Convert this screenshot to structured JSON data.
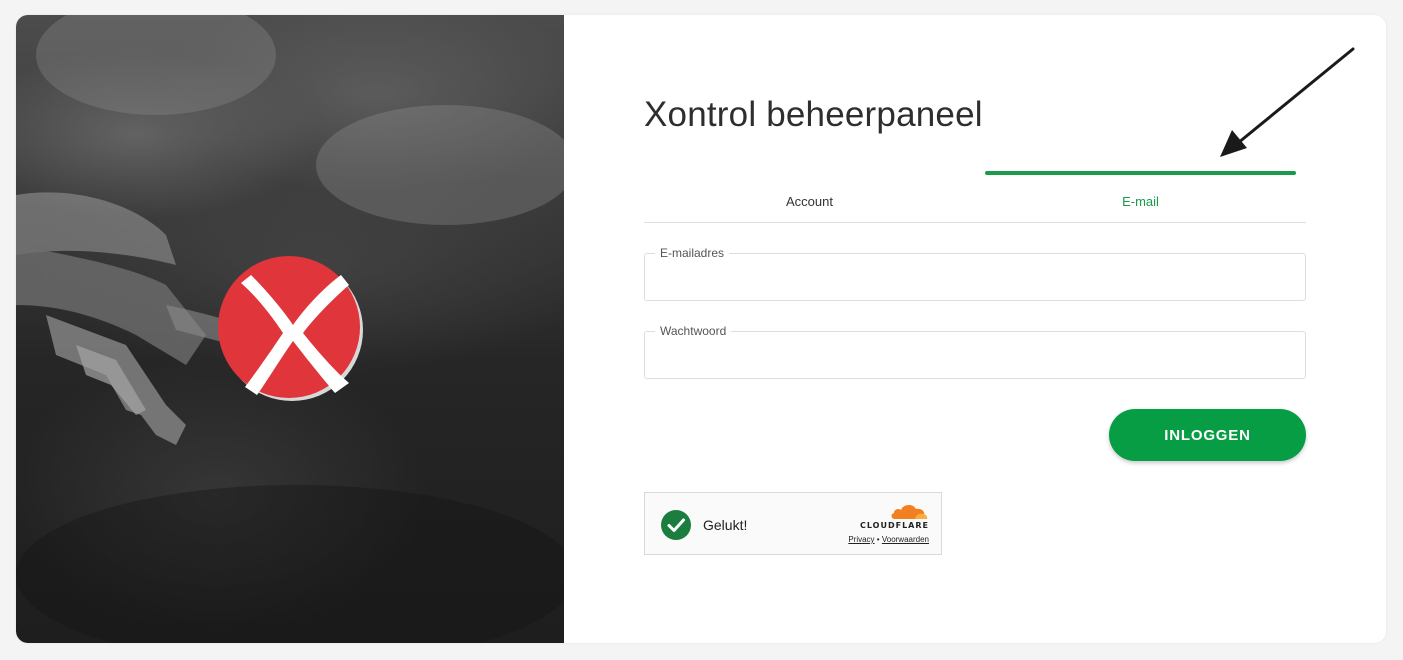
{
  "title": "Xontrol beheerpaneel",
  "tabs": [
    {
      "label": "Account",
      "active": false
    },
    {
      "label": "E-mail",
      "active": true
    }
  ],
  "form": {
    "email_label": "E-mailadres",
    "email_value": "",
    "password_label": "Wachtwoord",
    "password_value": "",
    "submit_label": "INLOGGEN"
  },
  "captcha": {
    "status": "Gelukt!",
    "brand": "CLOUDFLARE",
    "privacy_link": "Privacy",
    "separator": "•",
    "terms_link": "Voorwaarden"
  },
  "colors": {
    "accent": "#079d45",
    "logo_red": "#e0353b",
    "cloudflare_orange": "#f38020"
  },
  "icons": [
    "xontrol-logo",
    "success-check-icon",
    "cloudflare-cloud-icon",
    "annotation-arrow"
  ]
}
